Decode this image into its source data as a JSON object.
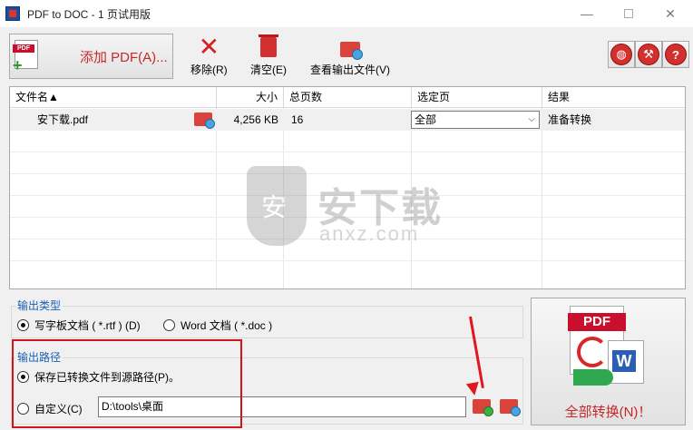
{
  "window": {
    "title": "PDF to DOC - 1 页试用版",
    "controls": {
      "minimize": "—",
      "maximize": "",
      "close": "✕"
    }
  },
  "toolbar": {
    "add_pdf_label": "添加 PDF(A)...",
    "pdf_tag": "PDF",
    "remove_label": "移除(R)",
    "clear_label": "清空(E)",
    "view_output_label": "查看输出文件(V)",
    "round_icons": [
      "globe-icon",
      "tools-icon",
      "help-icon"
    ],
    "help_glyph": "?",
    "globe_glyph": "◍",
    "tools_glyph": "⚒"
  },
  "table": {
    "columns": {
      "filename": "文件名▲",
      "size": "大小",
      "pages": "总页数",
      "selected": "选定页",
      "result": "结果"
    },
    "rows": [
      {
        "filename": "安下载.pdf",
        "size": "4,256 KB",
        "pages": "16",
        "selected": "全部",
        "result": "准备转换"
      }
    ]
  },
  "watermark": {
    "text": "安下载",
    "sub": "anxz.com"
  },
  "output_type": {
    "title": "输出类型",
    "options": [
      {
        "label": "写字板文档 ( *.rtf ) (D)",
        "checked": true
      },
      {
        "label": "Word 文档 ( *.doc )",
        "checked": false
      }
    ]
  },
  "output_path": {
    "title": "输出路径",
    "options": [
      {
        "label": "保存已转换文件到源路径(P)。",
        "checked": true
      },
      {
        "label": "自定义(C)",
        "checked": false
      }
    ],
    "custom_path": "D:\\tools\\桌面"
  },
  "convert": {
    "label": "全部转换(N)！",
    "pdf_tag": "PDF",
    "word_letter": "W"
  },
  "colors": {
    "accent_red": "#c62828",
    "group_title_blue": "#1a5fb4",
    "annotation_red": "#d0161b"
  }
}
